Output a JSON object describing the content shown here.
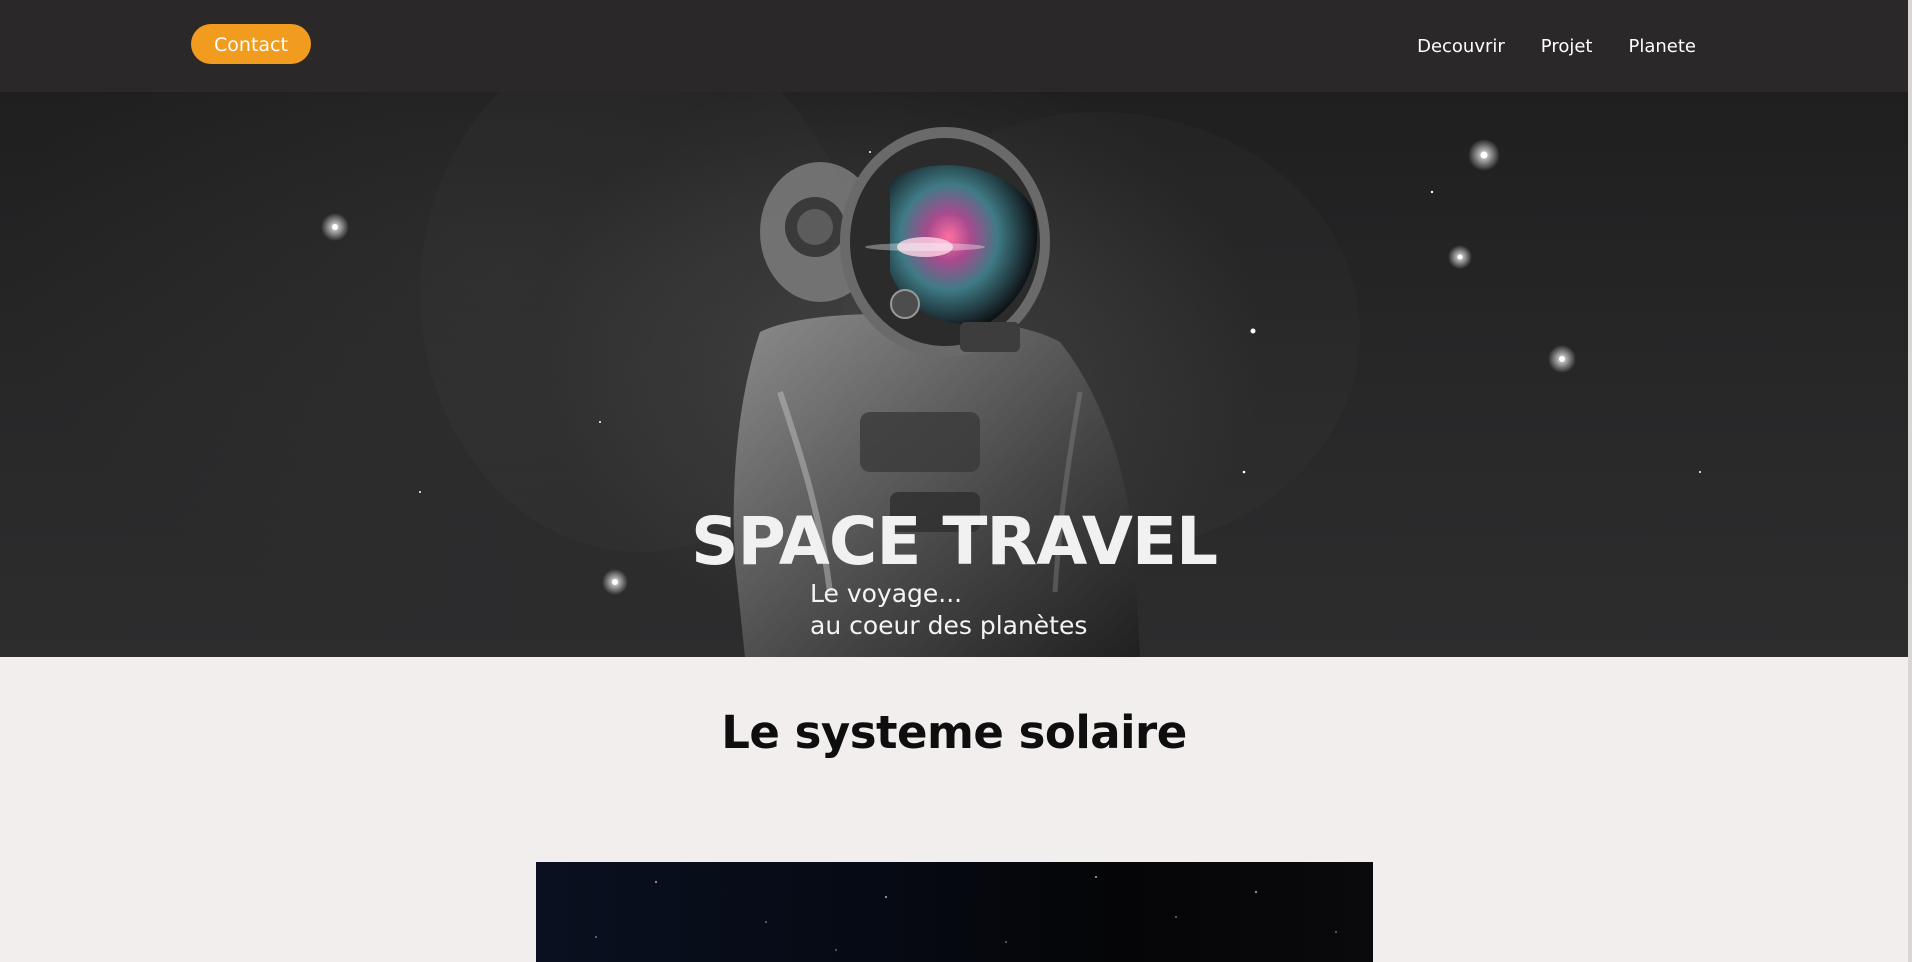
{
  "header": {
    "contact_label": "Contact",
    "nav": [
      "Decouvrir",
      "Projet",
      "Planete"
    ]
  },
  "hero": {
    "title": "SPACE TRAVEL",
    "subtitle_line1": "Le voyage...",
    "subtitle_line2": "au coeur des planètes"
  },
  "section": {
    "title": "Le systeme solaire"
  },
  "colors": {
    "accent": "#f29c1f",
    "topbar": "#2a2829",
    "page_bg": "#f1eeed"
  }
}
